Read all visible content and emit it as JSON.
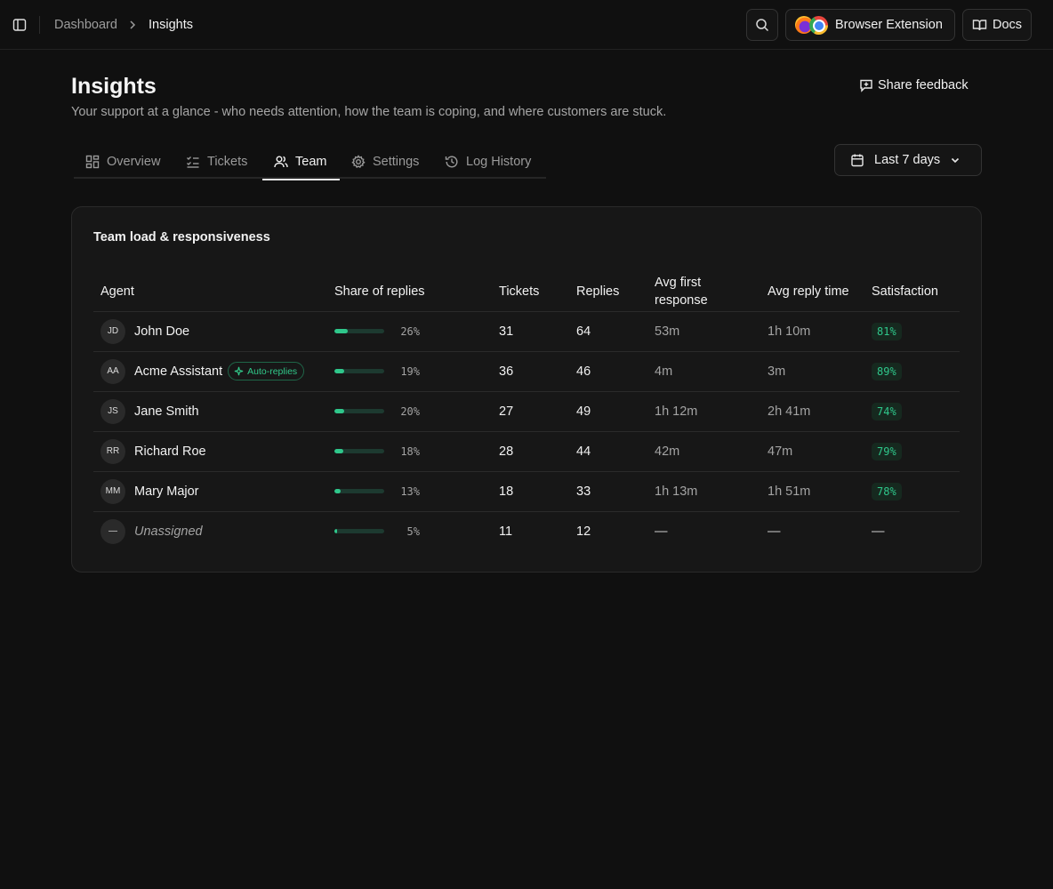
{
  "breadcrumb": {
    "root": "Dashboard",
    "current": "Insights"
  },
  "topbar": {
    "extension_label": "Browser Extension",
    "docs_label": "Docs"
  },
  "page": {
    "title": "Insights",
    "subtitle": "Your support at a glance - who needs attention, how the team is coping, and where customers are stuck.",
    "feedback_label": "Share feedback"
  },
  "tabs": [
    {
      "label": "Overview",
      "icon": "layout-grid-icon"
    },
    {
      "label": "Tickets",
      "icon": "list-checks-icon"
    },
    {
      "label": "Team",
      "icon": "users-icon",
      "active": true
    },
    {
      "label": "Settings",
      "icon": "gear-icon"
    },
    {
      "label": "Log History",
      "icon": "history-icon"
    }
  ],
  "range": {
    "label": "Last 7 days"
  },
  "team_card": {
    "title": "Team load & responsiveness",
    "columns": {
      "agent": "Agent",
      "share": "Share of replies",
      "tickets": "Tickets",
      "replies": "Replies",
      "first_response_1": "Avg first",
      "first_response_2": "response",
      "reply_time": "Avg reply time",
      "satisfaction": "Satisfaction"
    },
    "rows": [
      {
        "initials": "JD",
        "name": "John Doe",
        "share": 26,
        "share_label": "26%",
        "tickets": "31",
        "replies": "64",
        "first": "53m",
        "reply": "1h 10m",
        "sat": "81%"
      },
      {
        "initials": "AA",
        "name": "Acme Assistant",
        "badge": "Auto-replies",
        "share": 19,
        "share_label": "19%",
        "tickets": "36",
        "replies": "46",
        "first": "4m",
        "reply": "3m",
        "sat": "89%"
      },
      {
        "initials": "JS",
        "name": "Jane Smith",
        "share": 20,
        "share_label": "20%",
        "tickets": "27",
        "replies": "49",
        "first": "1h 12m",
        "reply": "2h 41m",
        "sat": "74%"
      },
      {
        "initials": "RR",
        "name": "Richard Roe",
        "share": 18,
        "share_label": "18%",
        "tickets": "28",
        "replies": "44",
        "first": "42m",
        "reply": "47m",
        "sat": "79%"
      },
      {
        "initials": "MM",
        "name": "Mary Major",
        "share": 13,
        "share_label": "13%",
        "tickets": "18",
        "replies": "33",
        "first": "1h 13m",
        "reply": "1h 51m",
        "sat": "78%"
      },
      {
        "initials": "—",
        "name": "Unassigned",
        "share": 5,
        "share_label": "5%",
        "tickets": "11",
        "replies": "12",
        "first": "—",
        "reply": "—",
        "sat": "—"
      }
    ]
  },
  "colors": {
    "accent": "#2fc78b",
    "background": "#101010",
    "card": "#171717"
  }
}
